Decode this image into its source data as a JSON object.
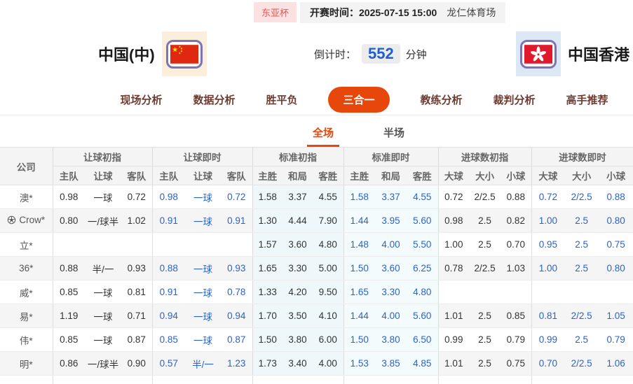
{
  "header": {
    "league_badge": "东亚杯",
    "kickoff_label": "开赛时间：",
    "kickoff_time": "2025-07-15 15:00",
    "venue": "龙仁体育场",
    "home_team": "中国(中)",
    "away_team": "中国香港",
    "countdown_label": "倒计时：",
    "countdown_value": "552",
    "countdown_unit": "分钟"
  },
  "icons": {
    "home_flag": "china-flag",
    "away_flag": "hongkong-flag",
    "crow_row_icon": "soccer-ball-icon"
  },
  "nav": {
    "tabs": [
      {
        "label": "现场分析",
        "active": false
      },
      {
        "label": "数据分析",
        "active": false
      },
      {
        "label": "胜平负",
        "active": false
      },
      {
        "label": "三合一",
        "active": true
      },
      {
        "label": "教练分析",
        "active": false
      },
      {
        "label": "裁判分析",
        "active": false
      },
      {
        "label": "高手推荐",
        "active": false
      }
    ]
  },
  "subtabs": [
    {
      "label": "全场",
      "active": true
    },
    {
      "label": "半场",
      "active": false
    }
  ],
  "table": {
    "company_header": "公司",
    "groups": [
      {
        "label": "让球初指",
        "cols": [
          "主队",
          "让球",
          "客队"
        ]
      },
      {
        "label": "让球即时",
        "cols": [
          "主队",
          "让球",
          "客队"
        ]
      },
      {
        "label": "标准初指",
        "cols": [
          "主胜",
          "和局",
          "客胜"
        ]
      },
      {
        "label": "标准即时",
        "cols": [
          "主胜",
          "和局",
          "客胜"
        ]
      },
      {
        "label": "进球数初指",
        "cols": [
          "大球",
          "大小",
          "小球"
        ]
      },
      {
        "label": "进球数即时",
        "cols": [
          "大球",
          "大小",
          "小球"
        ]
      }
    ],
    "rows": [
      {
        "company": "澳*",
        "icon": false,
        "cells": [
          "0.98",
          "一球",
          "0.72",
          "0.98",
          "一球",
          "0.72",
          "1.58",
          "3.37",
          "4.55",
          "1.58",
          "3.37",
          "4.55",
          "0.72",
          "2/2.5",
          "0.88",
          "0.72",
          "2/2.5",
          "0.88"
        ]
      },
      {
        "company": "Crow*",
        "icon": true,
        "cells": [
          "0.80",
          "一/球半",
          "1.02",
          "0.91",
          "一球",
          "0.91",
          "1.30",
          "4.44",
          "7.90",
          "1.44",
          "3.95",
          "5.60",
          "0.98",
          "2.5",
          "0.82",
          "1.00",
          "2.5",
          "0.80"
        ]
      },
      {
        "company": "立*",
        "icon": false,
        "cells": [
          "",
          "",
          "",
          "",
          "",
          "",
          "1.57",
          "3.60",
          "4.80",
          "1.48",
          "4.00",
          "5.50",
          "1.00",
          "2.5",
          "0.70",
          "0.95",
          "2.5",
          "0.75"
        ]
      },
      {
        "company": "36*",
        "icon": false,
        "cells": [
          "0.88",
          "半/一",
          "0.93",
          "0.88",
          "一球",
          "0.93",
          "1.65",
          "3.30",
          "5.00",
          "1.50",
          "3.60",
          "6.25",
          "0.78",
          "2/2.5",
          "1.03",
          "1.00",
          "2.5",
          "0.80"
        ]
      },
      {
        "company": "威*",
        "icon": false,
        "cells": [
          "0.85",
          "一球",
          "0.81",
          "0.91",
          "一球",
          "0.78",
          "1.33",
          "4.20",
          "9.50",
          "1.65",
          "3.30",
          "4.80",
          "",
          "",
          "",
          "",
          "",
          ""
        ]
      },
      {
        "company": "易*",
        "icon": false,
        "cells": [
          "1.19",
          "一球",
          "0.71",
          "0.94",
          "一球",
          "0.94",
          "1.70",
          "3.50",
          "4.10",
          "1.44",
          "4.00",
          "5.60",
          "1.01",
          "2.5",
          "0.85",
          "0.81",
          "2/2.5",
          "1.05"
        ]
      },
      {
        "company": "伟*",
        "icon": false,
        "cells": [
          "0.85",
          "一球",
          "0.87",
          "0.85",
          "一球",
          "0.87",
          "1.50",
          "3.80",
          "6.00",
          "1.50",
          "3.80",
          "6.50",
          "0.99",
          "2.5",
          "0.79",
          "0.99",
          "2.5",
          "0.79"
        ]
      },
      {
        "company": "明*",
        "icon": false,
        "cells": [
          "0.86",
          "一/球半",
          "0.90",
          "0.57",
          "半/一",
          "1.23",
          "1.73",
          "3.40",
          "4.00",
          "1.53",
          "3.85",
          "4.85",
          "1.01",
          "2.5",
          "0.75",
          "0.70",
          "2/2.5",
          "1.06"
        ]
      }
    ]
  },
  "colors": {
    "accent_orange": "#e8470c",
    "odds_blue": "#2a63c8",
    "countdown_blue": "#1f5fd0",
    "badge_bg": "#fbe1e1",
    "badge_text": "#e05a56",
    "nav_text": "#6f3b31",
    "cyan_initial_bg": "#eef8fb",
    "cyan_live_bg": "#f3fbfd",
    "flag_frame_purple": "#7e74b4"
  }
}
